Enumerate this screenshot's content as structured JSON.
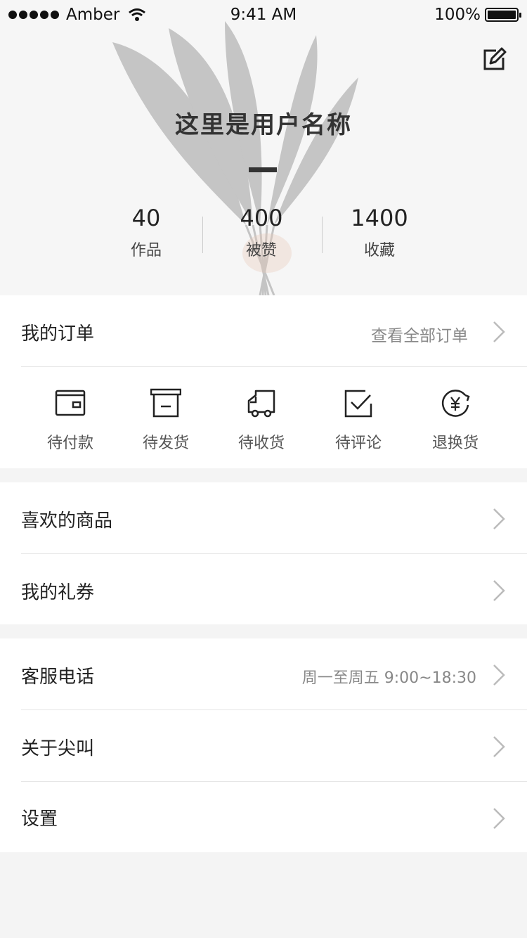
{
  "status_bar": {
    "carrier": "Amber",
    "time": "9:41 AM",
    "battery": "100%"
  },
  "profile": {
    "username": "这里是用户名称",
    "stats": [
      {
        "value": "40",
        "label": "作品"
      },
      {
        "value": "400",
        "label": "被赞"
      },
      {
        "value": "1400",
        "label": "收藏"
      }
    ]
  },
  "orders": {
    "title": "我的订单",
    "view_all": "查看全部订单",
    "items": [
      {
        "label": "待付款",
        "icon": "wallet-icon"
      },
      {
        "label": "待发货",
        "icon": "box-icon"
      },
      {
        "label": "待收货",
        "icon": "truck-icon"
      },
      {
        "label": "待评论",
        "icon": "check-icon"
      },
      {
        "label": "退换货",
        "icon": "yuan-refresh-icon"
      }
    ]
  },
  "menu_group_1": [
    {
      "title": "喜欢的商品"
    },
    {
      "title": "我的礼券"
    }
  ],
  "menu_group_2": [
    {
      "title": "客服电话",
      "meta": "周一至周五 9:00~18:30"
    },
    {
      "title": "关于尖叫"
    },
    {
      "title": "设置"
    }
  ],
  "colors": {
    "background": "#f4f4f4",
    "text": "#222222",
    "muted": "#888888",
    "separator": "#e6e6e6"
  }
}
